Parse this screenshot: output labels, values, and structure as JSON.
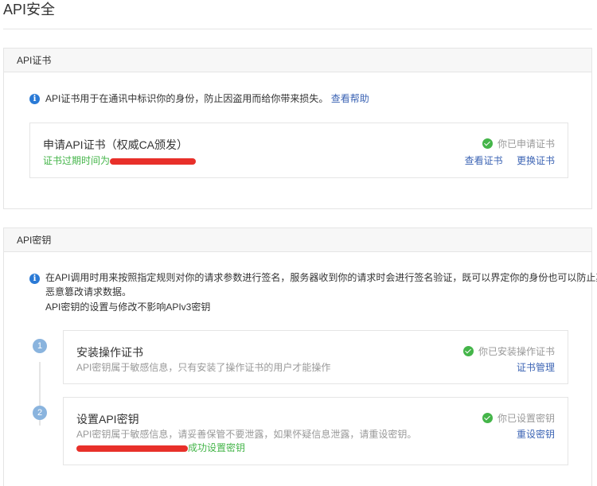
{
  "page": {
    "title": "API安全"
  },
  "cert_section": {
    "header": "API证书",
    "info_text": "API证书用于在通讯中标识你的身份，防止因盗用而给你带来损失。",
    "help_link": "查看帮助",
    "card": {
      "title": "申请API证书（权威CA颁发）",
      "expiry_label": "证书过期时间为",
      "status": "你已申请证书",
      "view_cert": "查看证书",
      "replace_cert": "更换证书"
    }
  },
  "key_section": {
    "header": "API密钥",
    "info_line1": "在API调用时用来按照指定规则对你的请求参数进行签名，服务器收到你的请求时会进行签名验证，既可以界定你的身份也可以防止其他人",
    "info_line2": "恶意篡改请求数据。",
    "info_line3": "API密钥的设置与修改不影响APIv3密钥",
    "steps": [
      {
        "number": "1",
        "title": "安装操作证书",
        "desc": "API密钥属于敏感信息，只有安装了操作证书的用户才能操作",
        "status": "你已安装操作证书",
        "action": "证书管理"
      },
      {
        "number": "2",
        "title": "设置API密钥",
        "desc": "API密钥属于敏感信息，请妥善保管不要泄露，如果怀疑信息泄露，请重设密钥。",
        "success_text": "成功设置密钥",
        "status": "你已设置密钥",
        "action": "重设密钥"
      }
    ]
  },
  "colors": {
    "accent_link": "#3c64b4",
    "success": "#44b549",
    "info": "#2a7ad6",
    "redaction": "#e8302a"
  }
}
